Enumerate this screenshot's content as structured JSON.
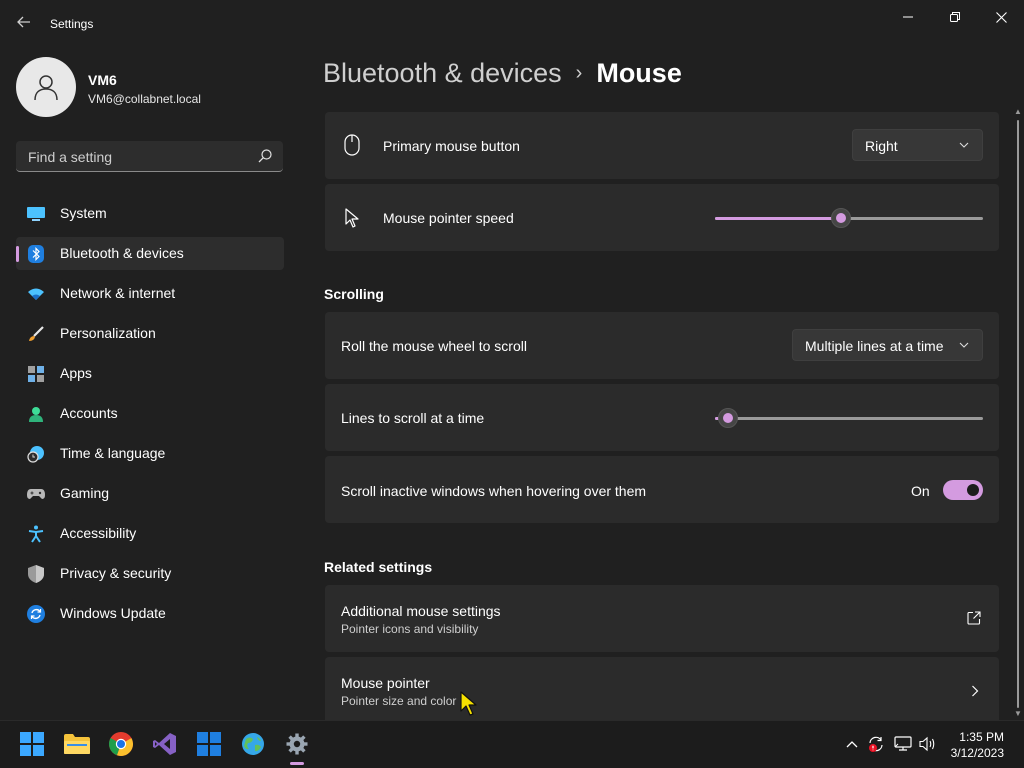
{
  "window": {
    "title": "Settings",
    "back_icon": "back-arrow-icon",
    "minimize_icon": "minimize-icon",
    "maximize_icon": "restore-icon",
    "close_icon": "close-icon"
  },
  "profile": {
    "name": "VM6",
    "email": "VM6@collabnet.local",
    "avatar_icon": "user-icon"
  },
  "search": {
    "placeholder": "Find a setting",
    "value": ""
  },
  "nav": {
    "items": [
      {
        "label": "System",
        "icon": "system-icon",
        "selected": false
      },
      {
        "label": "Bluetooth & devices",
        "icon": "bluetooth-icon",
        "selected": true
      },
      {
        "label": "Network & internet",
        "icon": "wifi-icon",
        "selected": false
      },
      {
        "label": "Personalization",
        "icon": "brush-icon",
        "selected": false
      },
      {
        "label": "Apps",
        "icon": "apps-icon",
        "selected": false
      },
      {
        "label": "Accounts",
        "icon": "accounts-icon",
        "selected": false
      },
      {
        "label": "Time & language",
        "icon": "globe-clock-icon",
        "selected": false
      },
      {
        "label": "Gaming",
        "icon": "gamepad-icon",
        "selected": false
      },
      {
        "label": "Accessibility",
        "icon": "accessibility-icon",
        "selected": false
      },
      {
        "label": "Privacy & security",
        "icon": "shield-icon",
        "selected": false
      },
      {
        "label": "Windows Update",
        "icon": "update-icon",
        "selected": false
      }
    ]
  },
  "header": {
    "parent": "Bluetooth & devices",
    "separator": "›",
    "current": "Mouse"
  },
  "settings": {
    "primary_button": {
      "label": "Primary mouse button",
      "value": "Right",
      "icon": "mouse-icon"
    },
    "pointer_speed": {
      "label": "Mouse pointer speed",
      "icon": "pointer-icon",
      "level": 0.47
    },
    "scrolling_title": "Scrolling",
    "roll_wheel": {
      "label": "Roll the mouse wheel to scroll",
      "value": "Multiple lines at a time"
    },
    "lines_to_scroll": {
      "label": "Lines to scroll at a time",
      "level": 0.05
    },
    "scroll_inactive": {
      "label": "Scroll inactive windows when hovering over them",
      "state": "On"
    },
    "related_title": "Related settings",
    "additional": {
      "label": "Additional mouse settings",
      "sub": "Pointer icons and visibility",
      "icon": "external-link-icon"
    },
    "mouse_pointer": {
      "label": "Mouse pointer",
      "sub": "Pointer size and color",
      "icon": "chevron-right-icon"
    }
  },
  "taskbar": {
    "apps": [
      "start-icon",
      "file-explorer-icon",
      "chrome-icon",
      "visual-studio-icon",
      "store-icon",
      "globe-app-icon",
      "settings-icon"
    ],
    "tray": [
      "chevron-up-icon",
      "sync-error-icon",
      "network-icon",
      "volume-icon"
    ],
    "time": "1:35 PM",
    "date": "3/12/2023"
  },
  "colors": {
    "accent": "#d49be0",
    "background": "#202020",
    "card": "#2b2b2b",
    "taskbar": "#1c1c1c"
  }
}
